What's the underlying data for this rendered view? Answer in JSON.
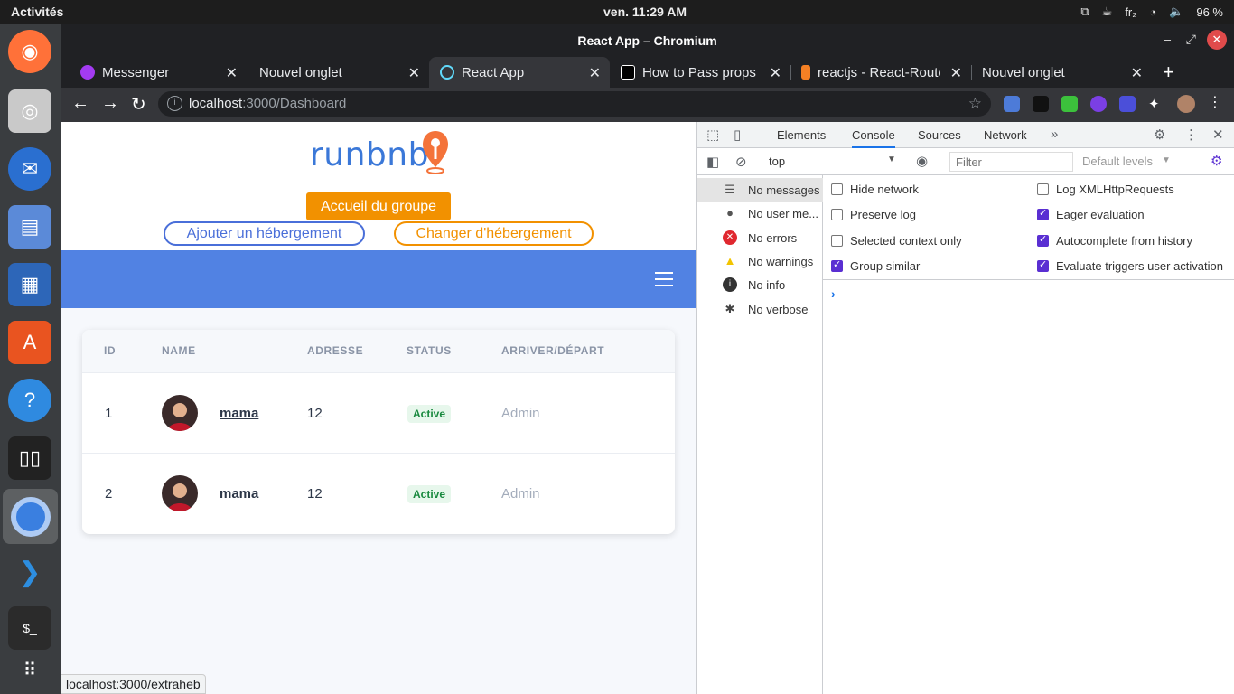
{
  "topbar": {
    "activities": "Activités",
    "clock": "ven. 11:29 AM",
    "keyboard": "fr₂",
    "battery": "96 %"
  },
  "window": {
    "title": "React App – Chromium"
  },
  "tabs": [
    {
      "label": "Messenger",
      "icon_color": "#a33bf2"
    },
    {
      "label": "Nouvel onglet",
      "icon_color": ""
    },
    {
      "label": "React App",
      "icon_color": "#61dafb"
    },
    {
      "label": "How to Pass props u",
      "icon_color": "#000000"
    },
    {
      "label": "reactjs - React-Route",
      "icon_color": "#f48024"
    },
    {
      "label": "Nouvel onglet",
      "icon_color": ""
    }
  ],
  "omnibox": {
    "host": "localhost",
    "path": ":3000/Dashboard"
  },
  "page": {
    "logo_text": "runbnb",
    "accueil_label": "Accueil du groupe",
    "ajouter_label": "Ajouter un hébergement",
    "changer_label": "Changer d'hébergement",
    "table": {
      "headers": [
        "ID",
        "NAME",
        "ADRESSE",
        "STATUS",
        "ARRIVER/DÉPART"
      ],
      "rows": [
        {
          "id": "1",
          "name": "mama",
          "adresse": "12",
          "status": "Active",
          "role": "Admin"
        },
        {
          "id": "2",
          "name": "mama",
          "adresse": "12",
          "status": "Active",
          "role": "Admin"
        }
      ]
    },
    "status_url": "localhost:3000/extraheb"
  },
  "devtools": {
    "tabs": [
      "Elements",
      "Console",
      "Sources",
      "Network"
    ],
    "context": "top",
    "filter_placeholder": "Filter",
    "levels": "Default levels",
    "sidebar": [
      {
        "label": "No messages",
        "icon": "list-icon"
      },
      {
        "label": "No user me...",
        "icon": "user-icon"
      },
      {
        "label": "No errors",
        "icon": "error-icon"
      },
      {
        "label": "No warnings",
        "icon": "warning-icon"
      },
      {
        "label": "No info",
        "icon": "info-icon"
      },
      {
        "label": "No verbose",
        "icon": "bug-icon"
      }
    ],
    "options_left": [
      {
        "label": "Hide network",
        "checked": false
      },
      {
        "label": "Preserve log",
        "checked": false
      },
      {
        "label": "Selected context only",
        "checked": false
      },
      {
        "label": "Group similar",
        "checked": true
      }
    ],
    "options_right": [
      {
        "label": "Log XMLHttpRequests",
        "checked": false
      },
      {
        "label": "Eager evaluation",
        "checked": true
      },
      {
        "label": "Autocomplete from history",
        "checked": true
      },
      {
        "label": "Evaluate triggers user activation",
        "checked": true
      }
    ]
  },
  "colors": {
    "accent_orange": "#f29100",
    "accent_blue": "#4a6fd9",
    "band_blue": "#5182e3",
    "badge_green": "#18893e"
  }
}
